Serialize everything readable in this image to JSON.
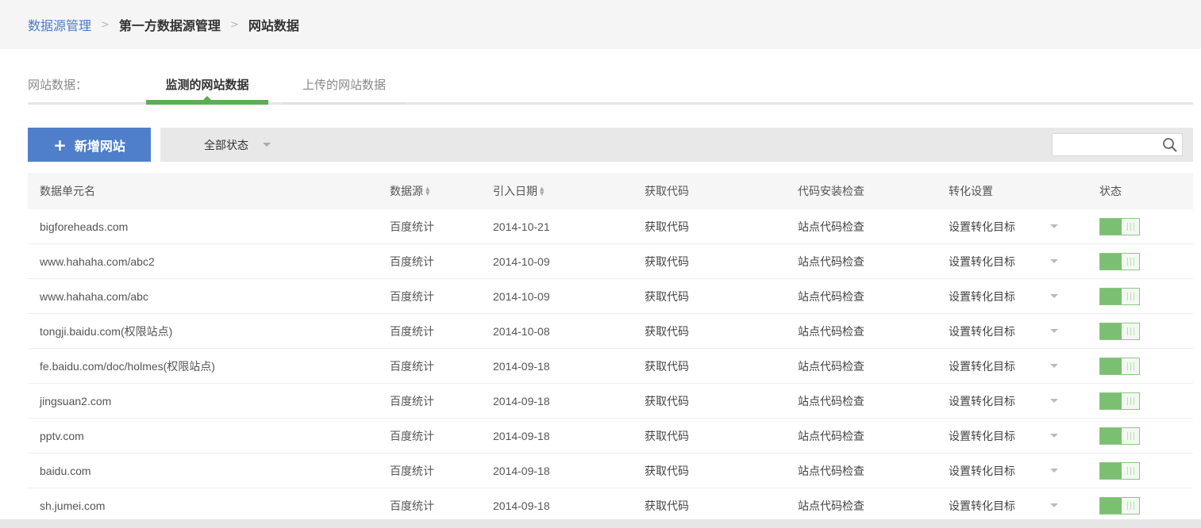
{
  "breadcrumb": {
    "root": "数据源管理",
    "sep": ">",
    "middle": "第一方数据源管理",
    "current": "网站数据"
  },
  "tabs": {
    "label": "网站数据：",
    "active": "监测的网站数据",
    "inactive": "上传的网站数据"
  },
  "toolbar": {
    "add_icon": "+",
    "add_label": "新增网站",
    "status_filter": "全部状态",
    "search_placeholder": ""
  },
  "table": {
    "headers": {
      "name": "数据单元名",
      "source": "数据源",
      "date": "引入日期",
      "code": "获取代码",
      "check": "代码安装检查",
      "conversion": "转化设置",
      "status": "状态"
    },
    "rows": [
      {
        "name": "bigforeheads.com",
        "source": "百度统计",
        "date": "2014-10-21",
        "code": "获取代码",
        "check": "站点代码检查",
        "conversion": "设置转化目标",
        "enabled": true
      },
      {
        "name": "www.hahaha.com/abc2",
        "source": "百度统计",
        "date": "2014-10-09",
        "code": "获取代码",
        "check": "站点代码检查",
        "conversion": "设置转化目标",
        "enabled": true
      },
      {
        "name": "www.hahaha.com/abc",
        "source": "百度统计",
        "date": "2014-10-09",
        "code": "获取代码",
        "check": "站点代码检查",
        "conversion": "设置转化目标",
        "enabled": true
      },
      {
        "name": "tongji.baidu.com(权限站点)",
        "source": "百度统计",
        "date": "2014-10-08",
        "code": "获取代码",
        "check": "站点代码检查",
        "conversion": "设置转化目标",
        "enabled": true
      },
      {
        "name": "fe.baidu.com/doc/holmes(权限站点)",
        "source": "百度统计",
        "date": "2014-09-18",
        "code": "获取代码",
        "check": "站点代码检查",
        "conversion": "设置转化目标",
        "enabled": true
      },
      {
        "name": "jingsuan2.com",
        "source": "百度统计",
        "date": "2014-09-18",
        "code": "获取代码",
        "check": "站点代码检查",
        "conversion": "设置转化目标",
        "enabled": true
      },
      {
        "name": "pptv.com",
        "source": "百度统计",
        "date": "2014-09-18",
        "code": "获取代码",
        "check": "站点代码检查",
        "conversion": "设置转化目标",
        "enabled": true
      },
      {
        "name": "baidu.com",
        "source": "百度统计",
        "date": "2014-09-18",
        "code": "获取代码",
        "check": "站点代码检查",
        "conversion": "设置转化目标",
        "enabled": true
      },
      {
        "name": "sh.jumei.com",
        "source": "百度统计",
        "date": "2014-09-18",
        "code": "获取代码",
        "check": "站点代码检查",
        "conversion": "设置转化目标",
        "enabled": true
      }
    ]
  },
  "colors": {
    "brand_blue": "#4f7fcb",
    "active_green": "#5cae53",
    "toggle_green": "#7bbf73"
  }
}
